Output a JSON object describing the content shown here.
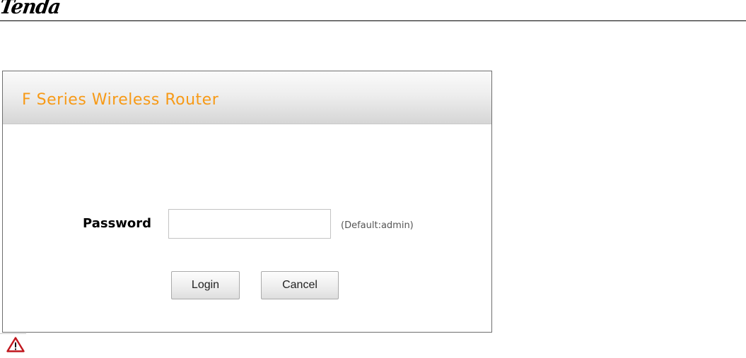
{
  "brand": {
    "logo_text": "Tenda"
  },
  "login": {
    "title": "F Series Wireless Router",
    "password_label": "Password",
    "password_value": "",
    "default_hint": "(Default:admin)",
    "login_label": "Login",
    "cancel_label": "Cancel"
  },
  "icons": {
    "warning": "warning-triangle-icon"
  },
  "colors": {
    "title_orange": "#f79a17",
    "warning_red": "#c0161d",
    "header_rule": "#000000"
  }
}
